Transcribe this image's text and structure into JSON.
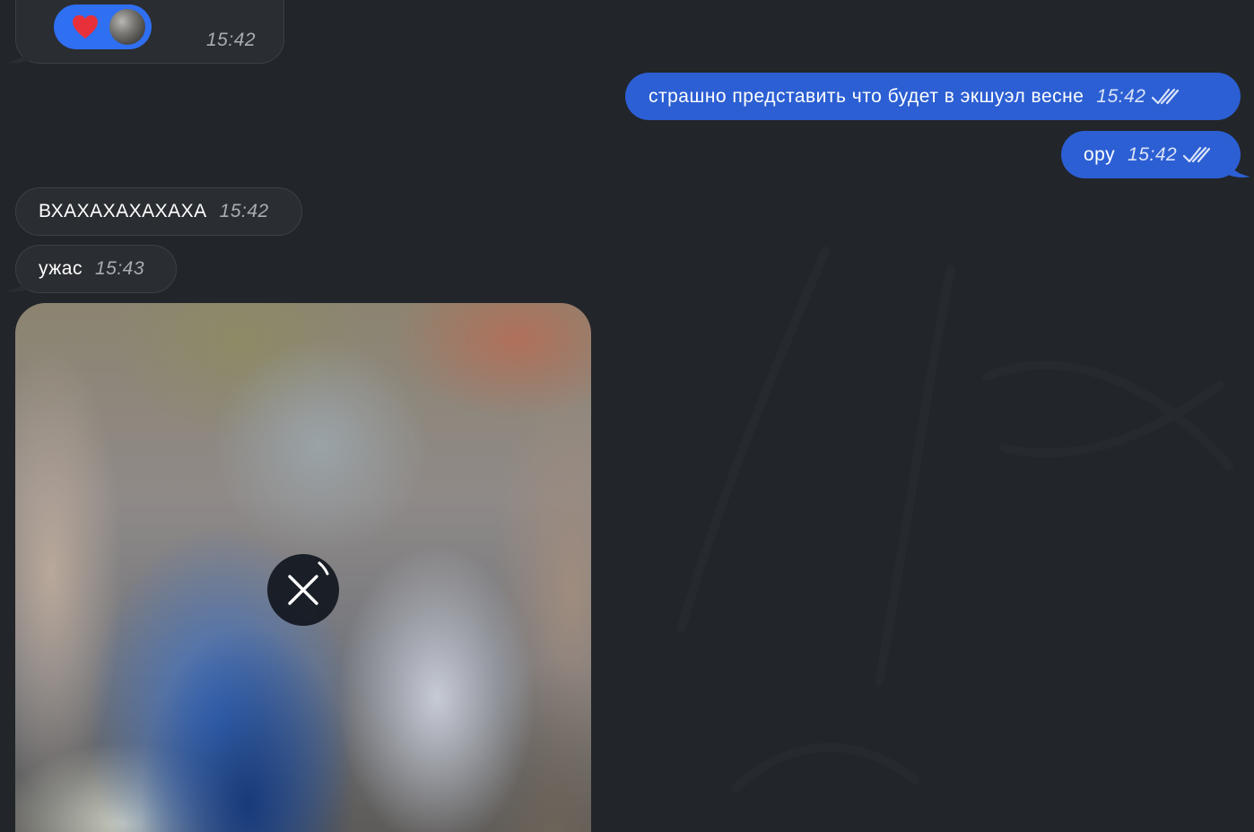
{
  "messages": [
    {
      "id": "m1",
      "direction": "incoming",
      "reactions": [
        {
          "emoji": "heart"
        }
      ],
      "time": "15:42"
    },
    {
      "id": "m2",
      "direction": "outgoing",
      "text": "страшно представить что будет в экшуэл весне",
      "time": "15:42",
      "status": "read"
    },
    {
      "id": "m3",
      "direction": "outgoing",
      "text": "ору",
      "time": "15:42",
      "status": "read"
    },
    {
      "id": "m4",
      "direction": "incoming",
      "text": "ВХАХАХАХАХАХА",
      "time": "15:42"
    },
    {
      "id": "m5",
      "direction": "incoming",
      "text": "ужас",
      "time": "15:43"
    },
    {
      "id": "m6",
      "direction": "incoming",
      "type": "photo",
      "state": "downloading"
    }
  ],
  "colors": {
    "background": "#222529",
    "incoming_bubble": "#2a2d31",
    "outgoing_bubble": "#2c5fd3",
    "reaction_pill": "#2f6ff2",
    "heart": "#e8303a"
  }
}
